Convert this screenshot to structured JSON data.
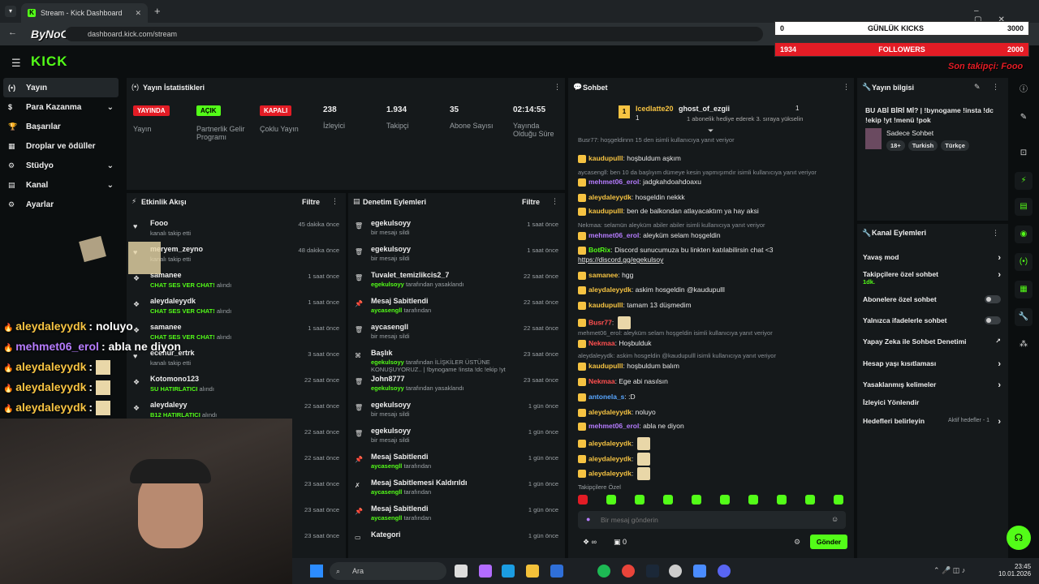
{
  "browser": {
    "tab_title": "Stream - Kick Dashboard",
    "url": "dashboard.kick.com/stream",
    "watermark": "ByNoGame"
  },
  "overlay": {
    "daily_kicks_label": "GÜNLÜK KICKS",
    "daily_kicks_current": "0",
    "daily_kicks_goal": "3000",
    "followers_label": "FOLLOWERS",
    "followers_current": "1934",
    "followers_goal": "2000",
    "last_follower": "Son takipçi: Fooo",
    "chat_overlay": [
      {
        "user": "aleydaleyydk",
        "msg": ": noluyo"
      },
      {
        "user": "mehmet06_erol",
        "msg": ": abla ne diyon"
      },
      {
        "user": "aleydaleyydk",
        "msg": ":"
      },
      {
        "user": "aleydaleyydk",
        "msg": ":"
      },
      {
        "user": "aleydaleyydk",
        "msg": ":"
      }
    ]
  },
  "brand": {
    "logo": "KICK"
  },
  "sidebar": {
    "items": [
      {
        "label": "Yayın",
        "icon": "broadcast-icon"
      },
      {
        "label": "Para Kazanma",
        "icon": "dollar-icon"
      },
      {
        "label": "Başarılar",
        "icon": "trophy-icon"
      },
      {
        "label": "Droplar ve ödüller",
        "icon": "gift-icon"
      },
      {
        "label": "Stüdyo",
        "icon": "gear-icon"
      },
      {
        "label": "Kanal",
        "icon": "grid-icon"
      },
      {
        "label": "Ayarlar",
        "icon": "settings-icon"
      }
    ]
  },
  "stats": {
    "title": "Yayın İstatistikleri",
    "live_badge": "YAYINDA",
    "live_label": "Yayın",
    "partner_badge": "AÇIK",
    "partner_label": "Partnerlik Gelir Programı",
    "multi_badge": "KAPALI",
    "multi_label": "Çoklu Yayın",
    "viewers": "238",
    "viewers_label": "İzleyici",
    "followers": "1.934",
    "followers_label": "Takipçi",
    "subs": "35",
    "subs_label": "Abone Sayısı",
    "duration": "02:14:55",
    "duration_label": "Yayında Olduğu Süre"
  },
  "activity": {
    "title": "Etkinlik Akışı",
    "filter": "Filtre",
    "rows": [
      {
        "name": "Fooo",
        "sub": "kanalı takip etti",
        "time": "45 dakika önce",
        "hl": false
      },
      {
        "name": "meryem_zeyno",
        "sub": "kanalı takip etti",
        "time": "48 dakika önce",
        "hl": false
      },
      {
        "name": "samanee",
        "sub": "CHAT SES VER CHAT!",
        "sub2": " alındı",
        "time": "1 saat önce",
        "hl": true
      },
      {
        "name": "aleydaleyydk",
        "sub": "CHAT SES VER CHAT!",
        "sub2": " alındı",
        "time": "1 saat önce",
        "hl": true
      },
      {
        "name": "samanee",
        "sub": "CHAT SES VER CHAT!",
        "sub2": " alındı",
        "time": "1 saat önce",
        "hl": true
      },
      {
        "name": "ecenur_ertrk",
        "sub": "kanalı takip etti",
        "time": "3 saat önce",
        "hl": false
      },
      {
        "name": "Kotomono123",
        "sub": "SU HATIRLATICI",
        "sub2": " alındı",
        "time": "22 saat önce",
        "hl": true
      },
      {
        "name": "aleydaleyy",
        "sub": "B12 HATIRLATICI",
        "sub2": " alındı",
        "time": "22 saat önce",
        "hl": true
      },
      {
        "name": "",
        "sub": "",
        "time": "22 saat önce",
        "hl": false
      },
      {
        "name": "",
        "sub": "",
        "time": "22 saat önce",
        "hl": false
      },
      {
        "name": "",
        "sub": "",
        "time": "23 saat önce",
        "hl": false
      },
      {
        "name": "",
        "sub": "",
        "time": "23 saat önce",
        "hl": false
      },
      {
        "name": "",
        "sub": "",
        "time": "23 saat önce",
        "hl": false
      }
    ]
  },
  "moderation": {
    "title": "Denetim Eylemleri",
    "filter": "Filtre",
    "rows": [
      {
        "name": "egekulsoyy",
        "sub": "bir mesajı sildi",
        "time": "1 saat önce"
      },
      {
        "name": "egekulsoyy",
        "sub": "bir mesajı sildi",
        "time": "1 saat önce"
      },
      {
        "name": "Tuvalet_temizlikcis2_7",
        "sub_user": "egekulsoyy",
        "sub": " tarafından yasaklandı",
        "time": "22 saat önce"
      },
      {
        "name": "Mesaj Sabitlendi",
        "sub_user": "aycasengll",
        "sub": " tarafından",
        "time": "22 saat önce"
      },
      {
        "name": "aycasengll",
        "sub": "bir mesajı sildi",
        "time": "22 saat önce"
      },
      {
        "name": "Başlık",
        "sub_user": "egekulsoyy",
        "sub": " tarafından İLİŞKİLER ÜSTÜNE KONUŞUYORUZ.. | !bynogame !insta !dc !ekip !yt !menü !pok olarak değiştirildi",
        "time": "23 saat önce"
      },
      {
        "name": "John8777",
        "sub_user": "egekulsoyy",
        "sub": " tarafından yasaklandı",
        "time": "23 saat önce"
      },
      {
        "name": "egekulsoyy",
        "sub": "bir mesajı sildi",
        "time": "1 gün önce"
      },
      {
        "name": "egekulsoyy",
        "sub": "bir mesajı sildi",
        "time": "1 gün önce"
      },
      {
        "name": "Mesaj Sabitlendi",
        "sub_user": "aycasengll",
        "sub": " tarafından",
        "time": "1 gün önce"
      },
      {
        "name": "Mesaj Sabitlemesi Kaldırıldı",
        "sub_user": "aycasengll",
        "sub": " tarafından",
        "time": "1 gün önce"
      },
      {
        "name": "Mesaj Sabitlendi",
        "sub_user": "aycasengll",
        "sub": " tarafından",
        "time": "1 gün önce"
      },
      {
        "name": "Kategori",
        "sub": "",
        "time": "1 gün önce"
      }
    ]
  },
  "chat": {
    "title": "Sohbet",
    "gifter": "Icedlatte20",
    "gifter_count": "1",
    "gift_user": "ghost_of_ezgii",
    "gift_count": "1",
    "gift_text": "1 abonelik hediye ederek 3. sıraya yükselin",
    "lines": [
      {
        "type": "reply",
        "text": "Busr77: hoşgeldinnn 15 den isimli kullanıcıya yanıt veriyor"
      },
      {
        "type": "msg",
        "user": "kaudupulll",
        "cls": "u-gold",
        "text": "hoşbuldum aşkım"
      },
      {
        "type": "reply",
        "text": "aycasengll: ben 10 da başlıyım dümeye kesin yapmışımdır isimli kullanıcıya yanıt veriyor"
      },
      {
        "type": "msg",
        "user": "mehmet06_erol",
        "cls": "u-purple",
        "text": "jadgkahdoahdoaxu"
      },
      {
        "type": "msg",
        "user": "aleydaleyydk",
        "cls": "u-gold",
        "text": "hosgeldin nekkk"
      },
      {
        "type": "msg",
        "user": "kaudupulll",
        "cls": "u-gold",
        "text": "ben de balkondan atlayacaktım ya hay aksi"
      },
      {
        "type": "reply",
        "text": "Nekmaa: selamün aleyküm abiler abiler isimli kullanıcıya yanıt veriyor"
      },
      {
        "type": "msg",
        "user": "mehmet06_erol",
        "cls": "u-purple",
        "text": "aleyküm selam hoşgeldin"
      },
      {
        "type": "msg",
        "user": "BotRix",
        "cls": "u-green",
        "text": "Discord sunucumuza bu linkten katılabilirsin chat <3"
      },
      {
        "type": "link",
        "text": "https://discord.gg/egekulsoy"
      },
      {
        "type": "msg",
        "user": "samanee",
        "cls": "u-gold",
        "text": "hgg"
      },
      {
        "type": "msg",
        "user": "aleydaleyydk",
        "cls": "u-gold",
        "text": "askim hosgeldin @kaudupulll"
      },
      {
        "type": "msg",
        "user": "kaudupulll",
        "cls": "u-gold",
        "text": "tamam 13 düşmedim"
      },
      {
        "type": "msg",
        "user": "Busr77",
        "cls": "u-red",
        "text": ""
      },
      {
        "type": "reply",
        "text": "mehmet06_erol: aleyküm selam hoşgeldin isimli kullanıcıya yanıt veriyor"
      },
      {
        "type": "msg",
        "user": "Nekmaa",
        "cls": "u-red",
        "text": "Hoşbulduk"
      },
      {
        "type": "reply",
        "text": "aleydaleyydk: askim hosgeldin @kaudupulll isimli kullanıcıya yanıt veriyor"
      },
      {
        "type": "msg",
        "user": "kaudupulll",
        "cls": "u-gold",
        "text": "hoşbuldum balım"
      },
      {
        "type": "msg",
        "user": "Nekmaa",
        "cls": "u-red",
        "text": "Ege abi nasılsın"
      },
      {
        "type": "msg",
        "user": "antonela_s",
        "cls": "u-blue",
        "text": ":D"
      },
      {
        "type": "msg",
        "user": "aleydaleyydk",
        "cls": "u-gold",
        "text": "noluyo"
      },
      {
        "type": "msg",
        "user": "mehmet06_erol",
        "cls": "u-purple",
        "text": "abla ne diyon"
      },
      {
        "type": "msg",
        "user": "aleydaleyydk",
        "cls": "u-gold",
        "text": ""
      },
      {
        "type": "msg",
        "user": "aleydaleyydk",
        "cls": "u-gold",
        "text": ""
      },
      {
        "type": "msg",
        "user": "aleydaleyydk",
        "cls": "u-gold",
        "text": ""
      }
    ],
    "follower_only": "Takipçilere Özel",
    "input_placeholder": "Bir mesaj gönderin",
    "points": "∞",
    "count": "0",
    "send": "Gönder"
  },
  "info": {
    "title": "Yayın bilgisi",
    "stream_title": "BU ABİ BİRİ Mİ? | !bynogame !insta !dc !ekip !yt !menü !pok",
    "category": "Sadece Sohbet",
    "tags": [
      "18+",
      "Turkish",
      "Türkçe"
    ]
  },
  "channel_actions": {
    "title": "Kanal Eylemleri",
    "rows": [
      {
        "label": "Yavaş mod",
        "ctl": "chevron"
      },
      {
        "label": "Takipçilere özel sohbet",
        "extra": "1dk.",
        "ctl": "chevron"
      },
      {
        "label": "Abonelere özel sohbet",
        "ctl": "toggle"
      },
      {
        "label": "Yalnızca ifadelerle sohbet",
        "ctl": "toggle"
      },
      {
        "label": "Yapay Zeka ile Sohbet Denetimi",
        "ctl": "external"
      },
      {
        "label": "Hesap yaşı kısıtlaması",
        "ctl": "chevron"
      },
      {
        "label": "Yasaklanmış kelimeler",
        "ctl": "chevron"
      },
      {
        "label": "İzleyici Yönlendir",
        "ctl": "none"
      },
      {
        "label": "Hedefleri belirleyin",
        "extra": "Aktif hedefler - 1",
        "ctl": "chevron"
      }
    ]
  },
  "taskbar": {
    "search": "Ara",
    "time": "23:45",
    "date": "10.01.2026"
  },
  "colors": {
    "brand": "#53fc18",
    "bg": "#0b0e0f",
    "panel": "#15191b",
    "live": "#e31c25"
  }
}
